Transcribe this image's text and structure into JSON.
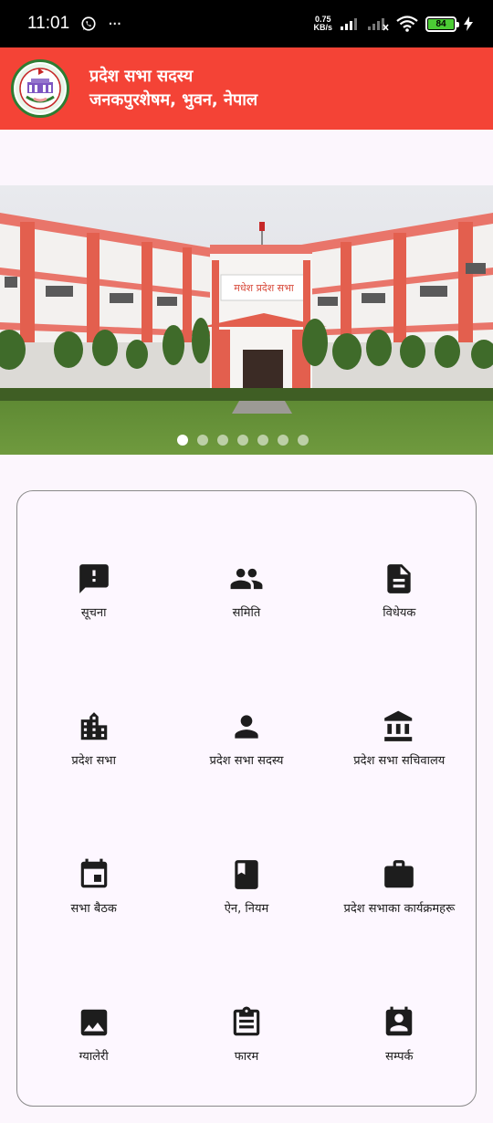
{
  "status_bar": {
    "time": "11:01",
    "more": "···",
    "speed_value": "0.75",
    "speed_unit": "KB/s",
    "battery": "84"
  },
  "header": {
    "title": "प्रदेश सभा सदस्य",
    "subtitle": "जनकपुरशेषम, भुवन, नेपाल"
  },
  "banner": {
    "sign_text": "मधेश प्रदेश सभा",
    "slides": 7,
    "active_slide": 0
  },
  "menu": [
    {
      "label": "सूचना",
      "icon": "feedback-icon"
    },
    {
      "label": "समिति",
      "icon": "people-icon"
    },
    {
      "label": "विधेयक",
      "icon": "document-icon"
    },
    {
      "label": "प्रदेश सभा",
      "icon": "building-icon"
    },
    {
      "label": "प्रदेश सभा सदस्य",
      "icon": "person-icon"
    },
    {
      "label": "प्रदेश सभा सचिवालय",
      "icon": "institution-icon"
    },
    {
      "label": "सभा बैठक",
      "icon": "calendar-icon"
    },
    {
      "label": "ऐन, नियम",
      "icon": "book-icon"
    },
    {
      "label": "प्रदेश सभाका कार्यक्रमहरू",
      "icon": "briefcase-icon"
    },
    {
      "label": "ग्यालेरी",
      "icon": "image-icon"
    },
    {
      "label": "फारम",
      "icon": "clipboard-icon"
    },
    {
      "label": "सम्पर्क",
      "icon": "contact-icon"
    }
  ]
}
